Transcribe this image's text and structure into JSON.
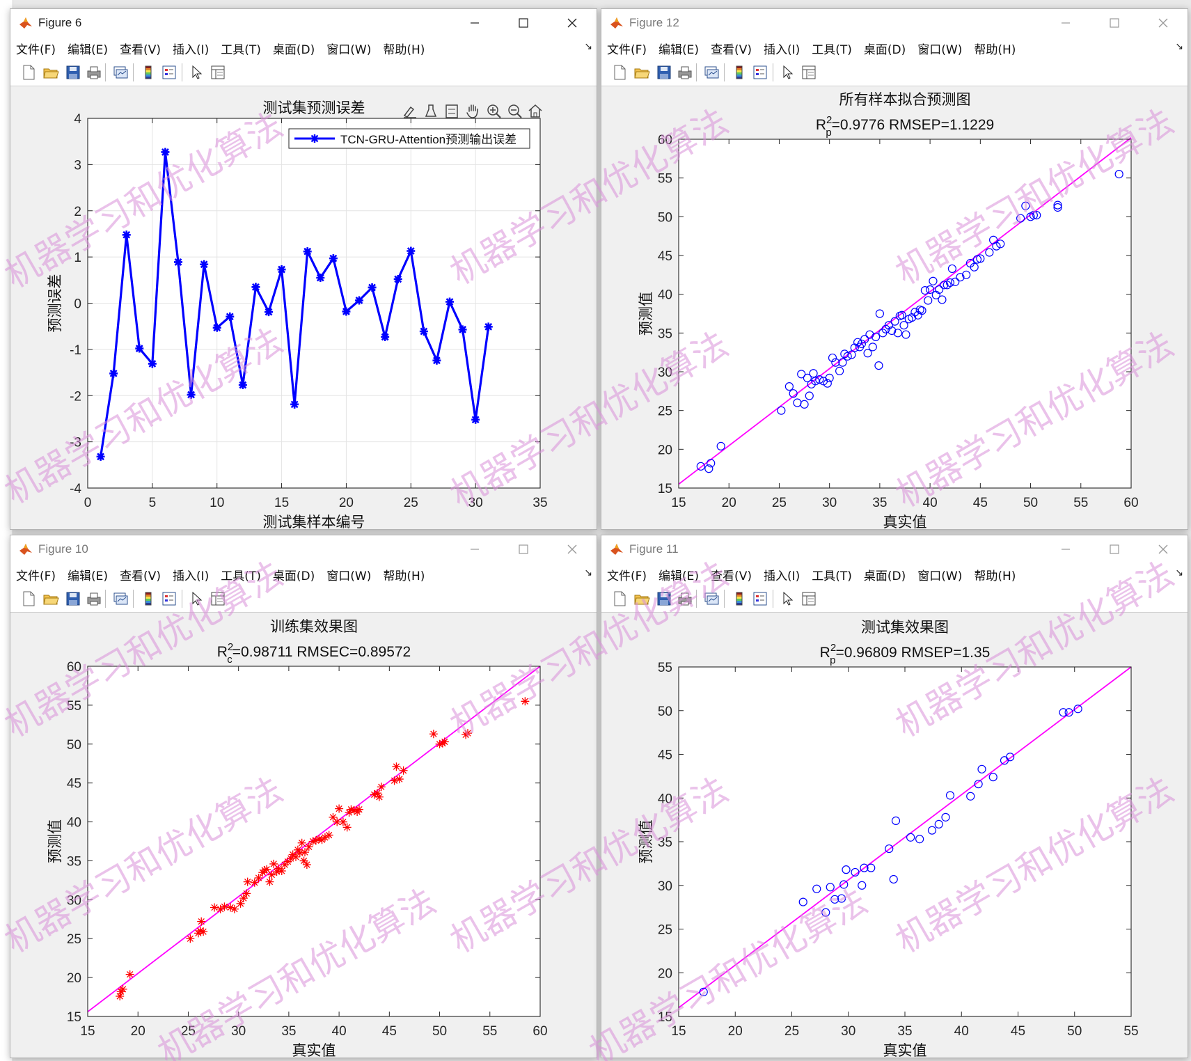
{
  "colors": {
    "line_blue": "#0000ff",
    "fit_magenta": "#ff00ff",
    "marker_red": "#ff0000",
    "watermark": "#d88fd8"
  },
  "menu": [
    "文件(F)",
    "编辑(E)",
    "查看(V)",
    "插入(I)",
    "工具(T)",
    "桌面(D)",
    "窗口(W)",
    "帮助(H)"
  ],
  "toolbar_icons": [
    "new-figure-icon",
    "open-file-icon",
    "save-icon",
    "print-icon",
    "link-plot-icon",
    "colorbar-icon",
    "legend-icon",
    "pointer-icon",
    "property-inspector-icon"
  ],
  "watermark_text": "机器学习和优化算法",
  "windows": {
    "fig6": {
      "title": "Figure 6"
    },
    "fig12": {
      "title": "Figure 12"
    },
    "fig10": {
      "title": "Figure 10"
    },
    "fig11": {
      "title": "Figure 11"
    }
  },
  "chart_data": [
    {
      "id": "fig6",
      "type": "line",
      "title": "测试集预测误差",
      "xlabel": "测试集样本编号",
      "ylabel": "预测误差",
      "xlim": [
        0,
        35
      ],
      "ylim": [
        -4,
        4
      ],
      "xticks": [
        0,
        5,
        10,
        15,
        20,
        25,
        30,
        35
      ],
      "yticks": [
        -4,
        -3,
        -2,
        -1,
        0,
        1,
        2,
        3,
        4
      ],
      "grid": true,
      "legend": "top-right",
      "series": [
        {
          "name": "TCN-GRU-Attention预测输出误差",
          "x": [
            1,
            2,
            3,
            4,
            5,
            6,
            7,
            8,
            9,
            10,
            11,
            12,
            13,
            14,
            15,
            16,
            17,
            18,
            19,
            20,
            21,
            22,
            23,
            24,
            25,
            26,
            27,
            28,
            29,
            30,
            31
          ],
          "y": [
            -3.32,
            -1.52,
            1.48,
            -0.98,
            -1.31,
            3.27,
            0.89,
            -1.98,
            0.84,
            -0.53,
            -0.29,
            -1.77,
            0.35,
            -0.19,
            0.73,
            -2.19,
            1.12,
            0.55,
            0.97,
            -0.18,
            0.06,
            0.34,
            -0.73,
            0.52,
            1.13,
            -0.61,
            -1.24,
            0.03,
            -0.57,
            -2.52,
            -0.51
          ]
        }
      ]
    },
    {
      "id": "fig12",
      "type": "scatter",
      "title": "所有样本拟合预测图",
      "subtitle_parts": [
        "R",
        "2",
        "p",
        "=0.9776  RMSEP=1.1229"
      ],
      "xlabel": "真实值",
      "ylabel": "预测值",
      "xlim": [
        15,
        60
      ],
      "ylim": [
        15,
        60
      ],
      "xticks": [
        15,
        20,
        25,
        30,
        35,
        40,
        45,
        50,
        55,
        60
      ],
      "yticks": [
        15,
        20,
        25,
        30,
        35,
        40,
        45,
        50,
        55,
        60
      ],
      "grid": false,
      "fit_line": [
        [
          15,
          15.5
        ],
        [
          60,
          60.2
        ]
      ],
      "points": [
        [
          17.2,
          17.8
        ],
        [
          18.2,
          18.2
        ],
        [
          18.0,
          17.5
        ],
        [
          19.2,
          20.4
        ],
        [
          25.2,
          25.0
        ],
        [
          26.0,
          28.1
        ],
        [
          26.4,
          27.2
        ],
        [
          26.8,
          26.0
        ],
        [
          27.2,
          29.7
        ],
        [
          27.5,
          25.8
        ],
        [
          27.8,
          29.2
        ],
        [
          28.0,
          26.9
        ],
        [
          28.2,
          28.4
        ],
        [
          28.4,
          29.8
        ],
        [
          28.6,
          28.8
        ],
        [
          29.0,
          29.0
        ],
        [
          29.4,
          28.8
        ],
        [
          29.8,
          28.5
        ],
        [
          30.0,
          29.2
        ],
        [
          30.3,
          31.8
        ],
        [
          30.6,
          31.2
        ],
        [
          31.0,
          30.1
        ],
        [
          31.3,
          31.2
        ],
        [
          31.5,
          32.3
        ],
        [
          31.8,
          32.0
        ],
        [
          32.2,
          32.2
        ],
        [
          32.5,
          33.1
        ],
        [
          32.8,
          33.8
        ],
        [
          33.0,
          33.2
        ],
        [
          33.2,
          33.6
        ],
        [
          33.5,
          34.2
        ],
        [
          33.8,
          32.4
        ],
        [
          34.0,
          34.8
        ],
        [
          34.3,
          33.2
        ],
        [
          34.6,
          34.5
        ],
        [
          34.9,
          30.8
        ],
        [
          35.0,
          37.5
        ],
        [
          35.3,
          35.0
        ],
        [
          35.6,
          35.5
        ],
        [
          35.9,
          36.0
        ],
        [
          36.2,
          35.3
        ],
        [
          36.5,
          36.5
        ],
        [
          36.8,
          35.0
        ],
        [
          37.0,
          37.2
        ],
        [
          37.2,
          37.3
        ],
        [
          37.4,
          36.0
        ],
        [
          37.6,
          34.8
        ],
        [
          37.9,
          36.8
        ],
        [
          38.2,
          37.0
        ],
        [
          38.5,
          37.7
        ],
        [
          38.8,
          37.3
        ],
        [
          39.0,
          38.0
        ],
        [
          39.2,
          37.9
        ],
        [
          39.5,
          40.5
        ],
        [
          39.8,
          39.2
        ],
        [
          40.0,
          40.6
        ],
        [
          40.3,
          41.7
        ],
        [
          40.6,
          39.9
        ],
        [
          40.9,
          40.6
        ],
        [
          41.2,
          39.3
        ],
        [
          41.4,
          41.2
        ],
        [
          41.7,
          41.2
        ],
        [
          42.0,
          41.5
        ],
        [
          42.2,
          43.3
        ],
        [
          42.5,
          41.6
        ],
        [
          43.0,
          42.2
        ],
        [
          43.6,
          42.5
        ],
        [
          44.0,
          44.0
        ],
        [
          44.4,
          43.5
        ],
        [
          44.7,
          44.5
        ],
        [
          45.0,
          44.6
        ],
        [
          45.9,
          45.4
        ],
        [
          46.3,
          47.0
        ],
        [
          46.6,
          46.2
        ],
        [
          47.0,
          46.5
        ],
        [
          49.0,
          49.8
        ],
        [
          49.5,
          51.4
        ],
        [
          50.0,
          50.0
        ],
        [
          50.3,
          50.2
        ],
        [
          50.6,
          50.2
        ],
        [
          52.7,
          51.2
        ],
        [
          52.7,
          51.5
        ],
        [
          58.8,
          55.5
        ]
      ],
      "marker": "o"
    },
    {
      "id": "fig10",
      "type": "scatter",
      "title": "训练集效果图",
      "subtitle_parts": [
        "R",
        "2",
        "c",
        "=0.98711  RMSEC=0.89572"
      ],
      "xlabel": "真实值",
      "ylabel": "预测值",
      "xlim": [
        15,
        60
      ],
      "ylim": [
        15,
        60
      ],
      "xticks": [
        15,
        20,
        25,
        30,
        35,
        40,
        45,
        50,
        55,
        60
      ],
      "yticks": [
        15,
        20,
        25,
        30,
        35,
        40,
        45,
        50,
        55,
        60
      ],
      "grid": false,
      "fit_line": [
        [
          15,
          15.6
        ],
        [
          60,
          60.0
        ]
      ],
      "points": [
        [
          18.2,
          17.6
        ],
        [
          18.3,
          18.2
        ],
        [
          18.5,
          18.5
        ],
        [
          19.2,
          20.4
        ],
        [
          25.2,
          25.0
        ],
        [
          26.0,
          25.7
        ],
        [
          26.2,
          26.0
        ],
        [
          26.5,
          25.9
        ],
        [
          26.3,
          27.2
        ],
        [
          27.6,
          29.0
        ],
        [
          28.2,
          28.8
        ],
        [
          28.6,
          29.1
        ],
        [
          29.2,
          29.0
        ],
        [
          29.6,
          28.8
        ],
        [
          30.2,
          29.5
        ],
        [
          30.5,
          30.2
        ],
        [
          30.8,
          30.8
        ],
        [
          30.9,
          32.3
        ],
        [
          31.6,
          32.2
        ],
        [
          32.0,
          32.8
        ],
        [
          32.4,
          33.5
        ],
        [
          32.6,
          33.8
        ],
        [
          32.8,
          33.9
        ],
        [
          33.1,
          32.3
        ],
        [
          33.3,
          33.2
        ],
        [
          33.5,
          34.6
        ],
        [
          33.8,
          33.6
        ],
        [
          34.0,
          34.0
        ],
        [
          34.3,
          33.7
        ],
        [
          34.6,
          34.5
        ],
        [
          34.9,
          34.9
        ],
        [
          35.2,
          35.3
        ],
        [
          35.4,
          35.8
        ],
        [
          35.7,
          35.5
        ],
        [
          35.9,
          36.4
        ],
        [
          36.1,
          36.0
        ],
        [
          36.3,
          37.3
        ],
        [
          36.5,
          35.0
        ],
        [
          36.6,
          36.1
        ],
        [
          36.8,
          34.5
        ],
        [
          37.0,
          36.8
        ],
        [
          37.4,
          37.5
        ],
        [
          37.7,
          37.6
        ],
        [
          38.0,
          37.8
        ],
        [
          38.3,
          37.7
        ],
        [
          38.6,
          38.0
        ],
        [
          39.0,
          38.3
        ],
        [
          39.4,
          40.6
        ],
        [
          39.8,
          40.0
        ],
        [
          40.0,
          41.7
        ],
        [
          40.4,
          40.0
        ],
        [
          40.8,
          39.3
        ],
        [
          41.0,
          41.2
        ],
        [
          41.2,
          41.6
        ],
        [
          41.5,
          41.5
        ],
        [
          41.8,
          41.3
        ],
        [
          42.0,
          41.6
        ],
        [
          43.5,
          43.5
        ],
        [
          43.8,
          43.7
        ],
        [
          44.0,
          43.2
        ],
        [
          44.2,
          44.5
        ],
        [
          45.5,
          45.3
        ],
        [
          45.7,
          47.1
        ],
        [
          46.0,
          45.5
        ],
        [
          46.4,
          46.6
        ],
        [
          49.4,
          51.3
        ],
        [
          50.0,
          50.0
        ],
        [
          50.3,
          50.1
        ],
        [
          50.5,
          50.3
        ],
        [
          52.6,
          51.2
        ],
        [
          52.8,
          51.4
        ],
        [
          58.5,
          55.5
        ]
      ],
      "marker": "*"
    },
    {
      "id": "fig11",
      "type": "scatter",
      "title": "测试集效果图",
      "subtitle_parts": [
        "R",
        "2",
        "p",
        "=0.96809  RMSEP=1.35"
      ],
      "xlabel": "真实值",
      "ylabel": "预测值",
      "xlim": [
        15,
        55
      ],
      "ylim": [
        15,
        55
      ],
      "xticks": [
        15,
        20,
        25,
        30,
        35,
        40,
        45,
        50,
        55
      ],
      "yticks": [
        15,
        20,
        25,
        30,
        35,
        40,
        45,
        50,
        55
      ],
      "grid": false,
      "fit_line": [
        [
          15,
          16.0
        ],
        [
          55,
          55.0
        ]
      ],
      "points": [
        [
          17.2,
          17.8
        ],
        [
          26.0,
          28.1
        ],
        [
          27.2,
          29.6
        ],
        [
          28.0,
          26.9
        ],
        [
          28.4,
          29.8
        ],
        [
          28.8,
          28.4
        ],
        [
          29.4,
          28.5
        ],
        [
          29.6,
          30.1
        ],
        [
          29.8,
          31.8
        ],
        [
          30.6,
          31.5
        ],
        [
          31.2,
          30.0
        ],
        [
          31.4,
          32.0
        ],
        [
          32.0,
          32.0
        ],
        [
          33.6,
          34.2
        ],
        [
          34.0,
          30.7
        ],
        [
          34.2,
          37.4
        ],
        [
          35.5,
          35.5
        ],
        [
          36.3,
          35.3
        ],
        [
          37.4,
          36.3
        ],
        [
          38.0,
          37.0
        ],
        [
          38.6,
          37.8
        ],
        [
          39.0,
          40.3
        ],
        [
          40.8,
          40.2
        ],
        [
          41.5,
          41.6
        ],
        [
          41.8,
          43.3
        ],
        [
          42.8,
          42.4
        ],
        [
          43.8,
          44.3
        ],
        [
          44.3,
          44.7
        ],
        [
          49.0,
          49.8
        ],
        [
          49.5,
          49.8
        ],
        [
          50.3,
          50.2
        ]
      ],
      "marker": "o"
    }
  ]
}
